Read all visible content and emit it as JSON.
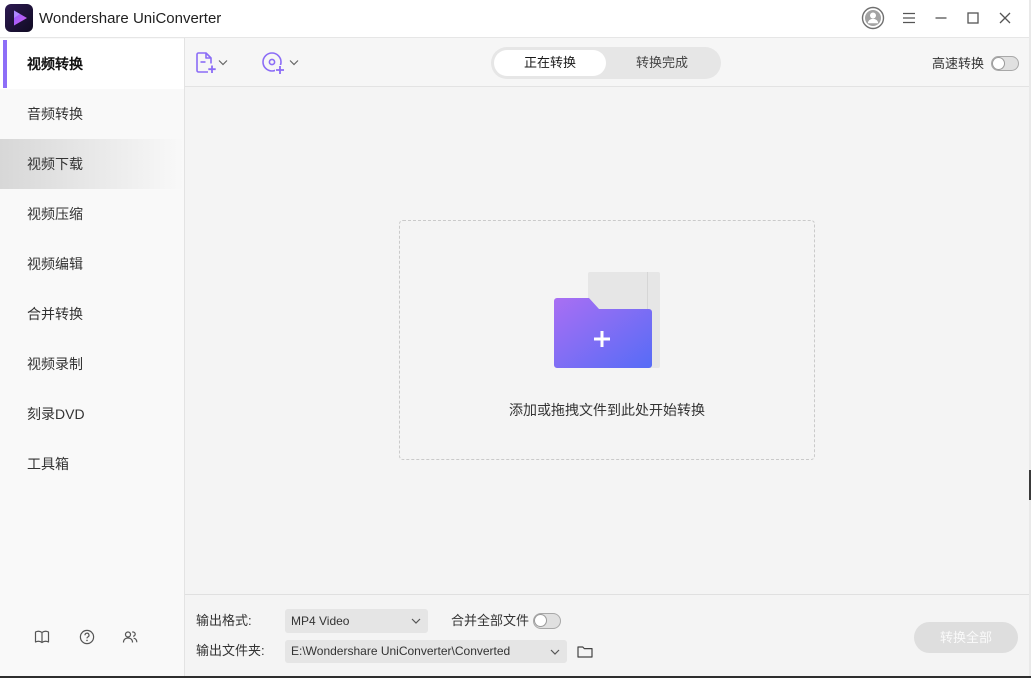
{
  "window": {
    "title": "Wondershare UniConverter",
    "app_icon": "uniconverter-logo-icon"
  },
  "titlebar_controls": {
    "account_icon": "account-icon",
    "menu_icon": "hamburger-menu-icon",
    "minimize_icon": "minimize-icon",
    "maximize_icon": "maximize-icon",
    "close_icon": "close-icon"
  },
  "sidebar": {
    "items": [
      {
        "label": "视频转换",
        "active": true,
        "highlighted": false
      },
      {
        "label": "音频转换",
        "active": false,
        "highlighted": false
      },
      {
        "label": "视频下载",
        "active": false,
        "highlighted": true
      },
      {
        "label": "视频压缩",
        "active": false,
        "highlighted": false
      },
      {
        "label": "视频编辑",
        "active": false,
        "highlighted": false
      },
      {
        "label": "合并转换",
        "active": false,
        "highlighted": false
      },
      {
        "label": "视频录制",
        "active": false,
        "highlighted": false
      },
      {
        "label": "刻录DVD",
        "active": false,
        "highlighted": false
      },
      {
        "label": "工具箱",
        "active": false,
        "highlighted": false
      }
    ],
    "footer_icons": [
      "book-icon",
      "help-icon",
      "users-icon"
    ]
  },
  "toolbar": {
    "add_files_icon": "add-file-icon",
    "add_from_device_icon": "add-disc-icon",
    "tabs": [
      {
        "label": "正在转换",
        "active": true
      },
      {
        "label": "转换完成",
        "active": false
      }
    ],
    "high_speed": {
      "label": "高速转换",
      "enabled": false
    }
  },
  "dropzone": {
    "icon": "add-folder-icon",
    "hint": "添加或拖拽文件到此处开始转换"
  },
  "footer": {
    "output_format": {
      "label": "输出格式:",
      "value": "MP4 Video"
    },
    "merge_all": {
      "label": "合并全部文件",
      "enabled": false
    },
    "output_folder": {
      "label": "输出文件夹:",
      "value": "E:\\Wondershare UniConverter\\Converted"
    },
    "convert_all": {
      "label": "转换全部",
      "disabled": true
    }
  },
  "colors": {
    "accent": "#8d6ef7",
    "folder_gradient_start": "#a96ff3",
    "folder_gradient_end": "#566cf6",
    "disabled_button": "#dedede"
  }
}
